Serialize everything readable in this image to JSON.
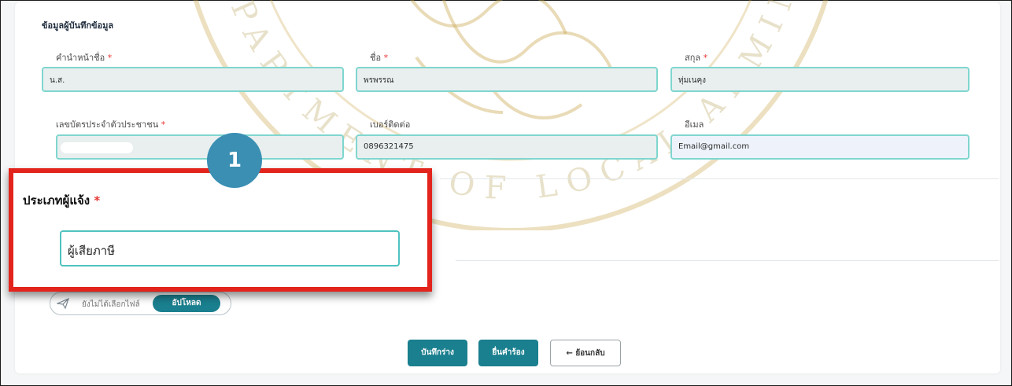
{
  "section": {
    "title": "ข้อมูลผู้บันทึกข้อมูล"
  },
  "fields": {
    "prefix": {
      "label": "คำนำหน้าชื่อ",
      "value": "น.ส."
    },
    "first_name": {
      "label": "ชื่อ",
      "value": "พรพรรณ"
    },
    "last_name": {
      "label": "สกุล",
      "value": "ทุ่มเนคุง"
    },
    "id_card": {
      "label": "เลขบัตรประจำตัวประชาชน",
      "value": ""
    },
    "phone": {
      "label": "เบอร์ติดต่อ",
      "value": "0896321475"
    },
    "email": {
      "label": "อีเมล",
      "value": "Email@gmail.com"
    },
    "required_mark": "*"
  },
  "reporter_type": {
    "label": "ประเภทผู้แจ้ง",
    "value": "ผู้เสียภาษี"
  },
  "upload": {
    "status": "ยังไม่ได้เลือกไฟล์",
    "button": "อัปโหลด",
    "icon": "paper-plane-icon"
  },
  "actions": {
    "save_draft": "บันทึกร่าง",
    "submit": "ยื่นคำร้อง",
    "back": "← ย้อนกลับ"
  },
  "callout": {
    "number": "1"
  },
  "watermark": {
    "text": "DEPARTMENT OF LOCAL ADMINISTRATION"
  },
  "colors": {
    "primary": "#1a7f8e",
    "highlight": "#e2241c",
    "badge": "#3a8fb3",
    "input_border": "#7fd6cf"
  }
}
